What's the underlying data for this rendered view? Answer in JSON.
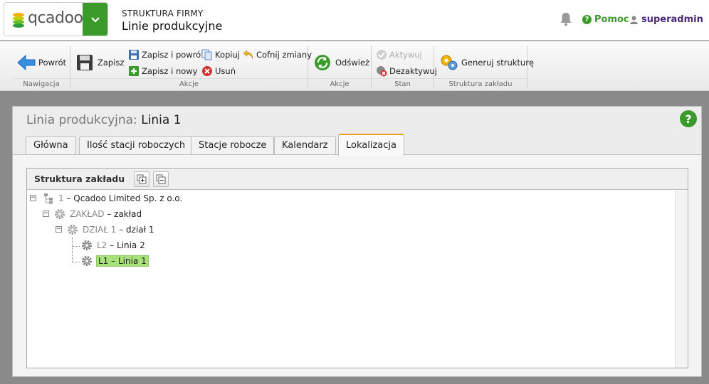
{
  "header": {
    "logo_text": "qcadoo",
    "module_title": "STRUKTURA FIRMY",
    "module_sub": "Linie produkcyjne",
    "help_label": "Pomoc",
    "user_label": "superadmin",
    "accent_color": "#3a9a2a"
  },
  "ribbon": {
    "nav": {
      "label": "Nawigacja",
      "back": "Powrót"
    },
    "actions": {
      "label": "Akcje",
      "save": "Zapisz",
      "save_back": "Zapisz i powrót",
      "save_new": "Zapisz i nowy",
      "copy": "Kopiuj",
      "delete": "Usuń",
      "undo": "Cofnij zmiany"
    },
    "actions2": {
      "label": "Akcje",
      "refresh": "Odśwież"
    },
    "state": {
      "label": "Stan",
      "activate": "Aktywuj",
      "deactivate": "Dezaktywuj"
    },
    "structure": {
      "label": "Struktura zakładu",
      "generate": "Generuj strukturę"
    }
  },
  "panel": {
    "title_label": "Linia produkcyjna:",
    "title_value": "Linia 1",
    "tabs": [
      {
        "label": "Główna"
      },
      {
        "label": "Ilość stacji roboczych"
      },
      {
        "label": "Stacje robocze"
      },
      {
        "label": "Kalendarz"
      },
      {
        "label": "Lokalizacja"
      }
    ],
    "active_tab": "Lokalizacja"
  },
  "tree": {
    "title": "Struktura zakładu",
    "nodes": [
      {
        "code": "1",
        "name": "Qcadoo Limited Sp. z o.o."
      },
      {
        "code": "ZAKŁAD",
        "name": "zakład"
      },
      {
        "code": "DZIAŁ 1",
        "name": "dział 1"
      },
      {
        "code": "L2",
        "name": "Linia 2"
      },
      {
        "code": "L1",
        "name": "Linia 1"
      }
    ],
    "separator": " – ",
    "selected_highlight": "#a8e27a"
  }
}
